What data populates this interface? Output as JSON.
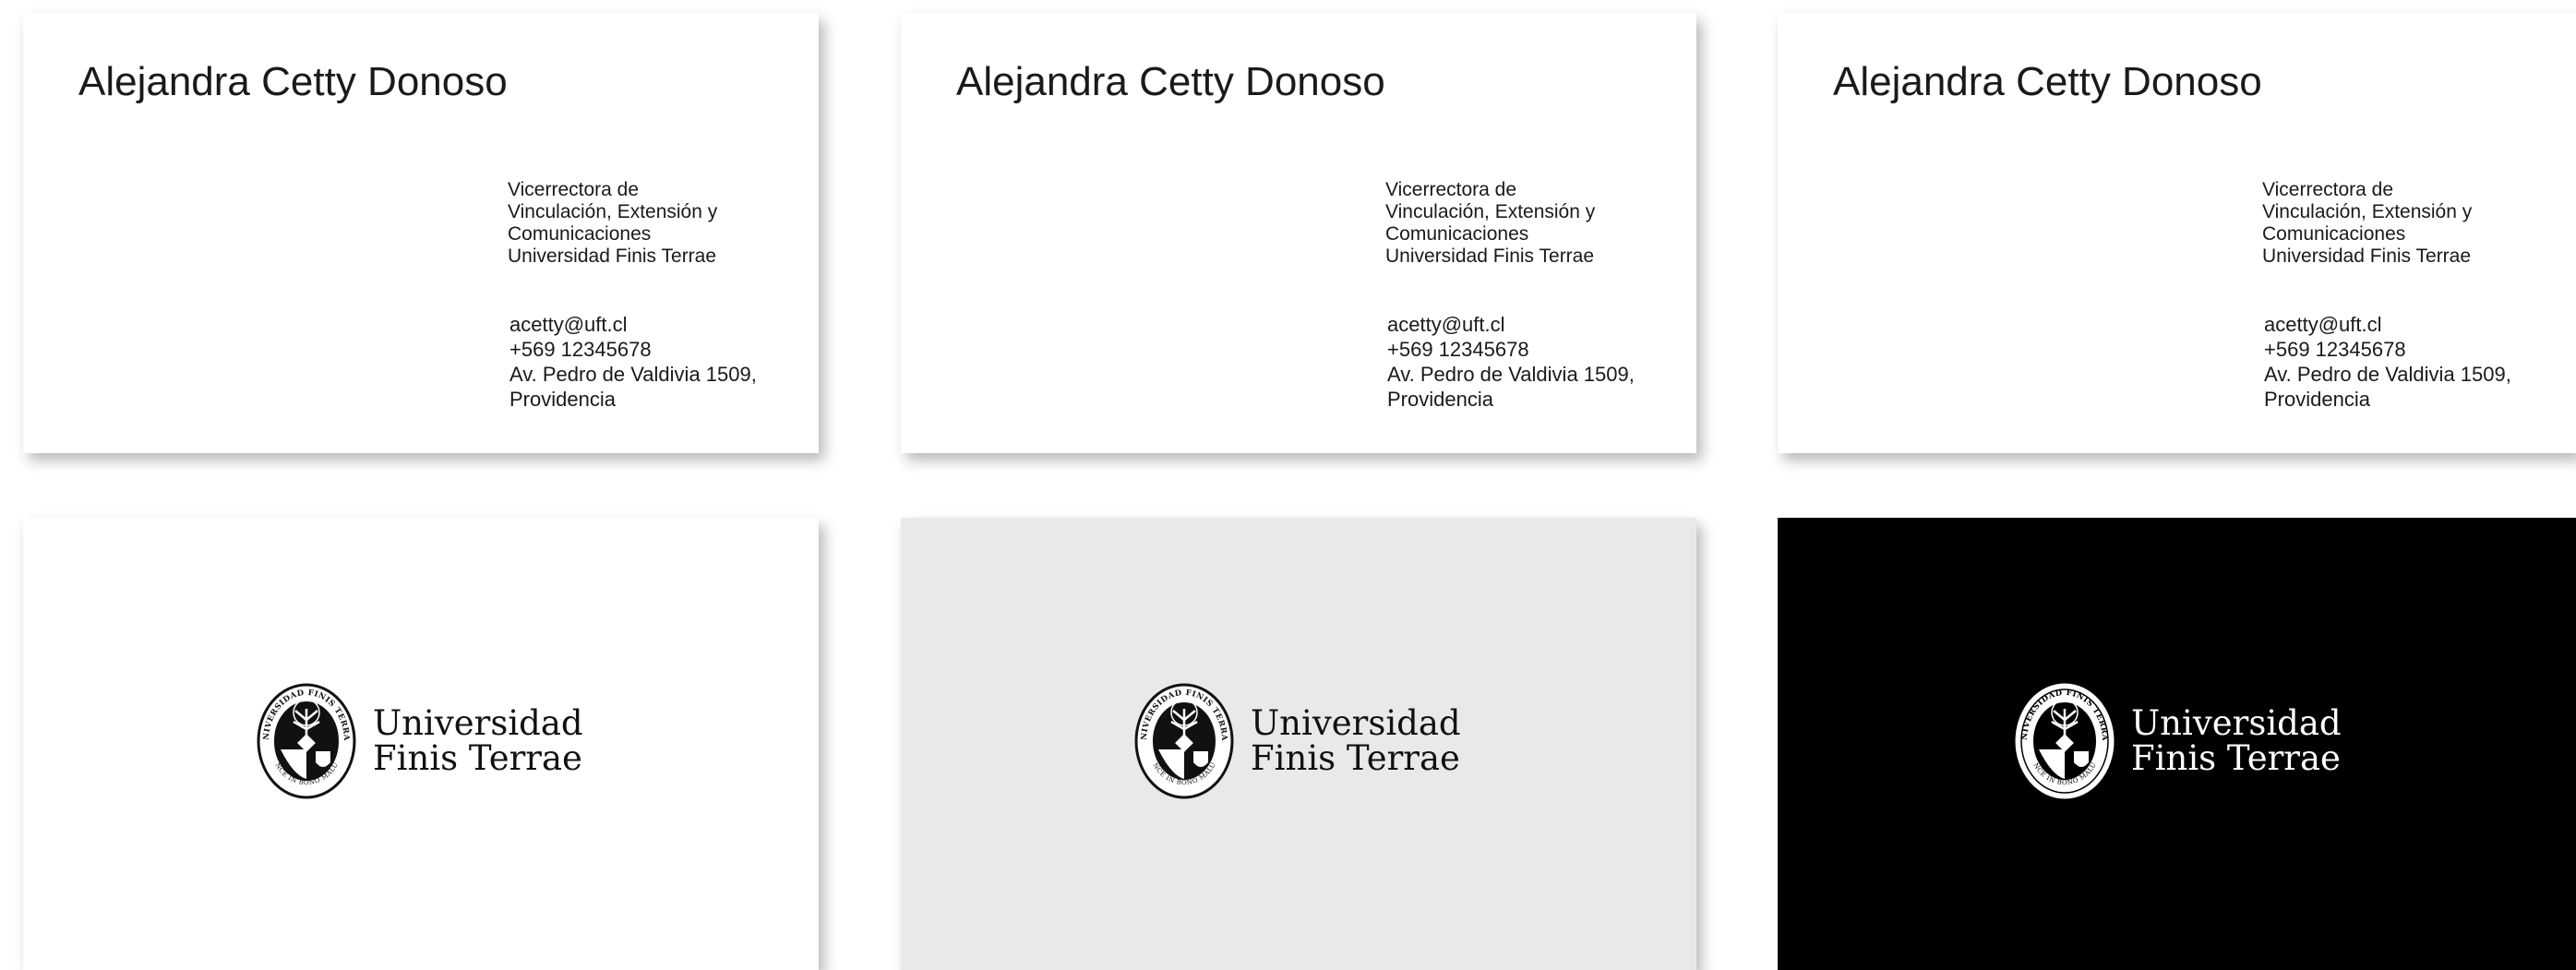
{
  "front_cards": [
    {
      "name": "Alejandra Cetty Donoso",
      "role_lines": [
        "Vicerrectora de",
        "Vinculación, Extensión y",
        "Comunicaciones",
        "Universidad Finis Terrae"
      ],
      "email": "acetty@uft.cl",
      "phone": "+569 12345678",
      "address_line1": "Av. Pedro de Valdivia 1509,",
      "address_line2": "Providencia"
    },
    {
      "name": "Alejandra Cetty Donoso",
      "role_lines": [
        "Vicerrectora de",
        "Vinculación, Extensión y",
        "Comunicaciones",
        "Universidad Finis Terrae"
      ],
      "email": "acetty@uft.cl",
      "phone": "+569 12345678",
      "address_line1": "Av. Pedro de Valdivia 1509,",
      "address_line2": "Providencia"
    },
    {
      "name": "Alejandra Cetty Donoso",
      "role_lines": [
        "Vicerrectora de",
        "Vinculación, Extensión y",
        "Comunicaciones",
        "Universidad Finis Terrae"
      ],
      "email": "acetty@uft.cl",
      "phone": "+569 12345678",
      "address_line1": "Av. Pedro de Valdivia 1509,",
      "address_line2": "Providencia"
    }
  ],
  "back_cards": [
    {
      "background": "#ffffff",
      "ink": "#111111",
      "wordmark_line1": "Universidad",
      "wordmark_line2": "Finis Terrae",
      "seal_text": "UNIVERSIDAD FINIS TERRAE",
      "seal_motto": "VINCE IN BONO MALUM"
    },
    {
      "background": "#e9e9e9",
      "ink": "#111111",
      "wordmark_line1": "Universidad",
      "wordmark_line2": "Finis Terrae",
      "seal_text": "UNIVERSIDAD FINIS TERRAE",
      "seal_motto": "VINCE IN BONO MALUM"
    },
    {
      "background": "#000000",
      "ink": "#ffffff",
      "wordmark_line1": "Universidad",
      "wordmark_line2": "Finis Terrae",
      "seal_text": "UNIVERSIDAD FINIS TERRAE",
      "seal_motto": "VINCE IN BONO MALUM"
    }
  ],
  "icons": {
    "seal": "university-seal-icon"
  }
}
